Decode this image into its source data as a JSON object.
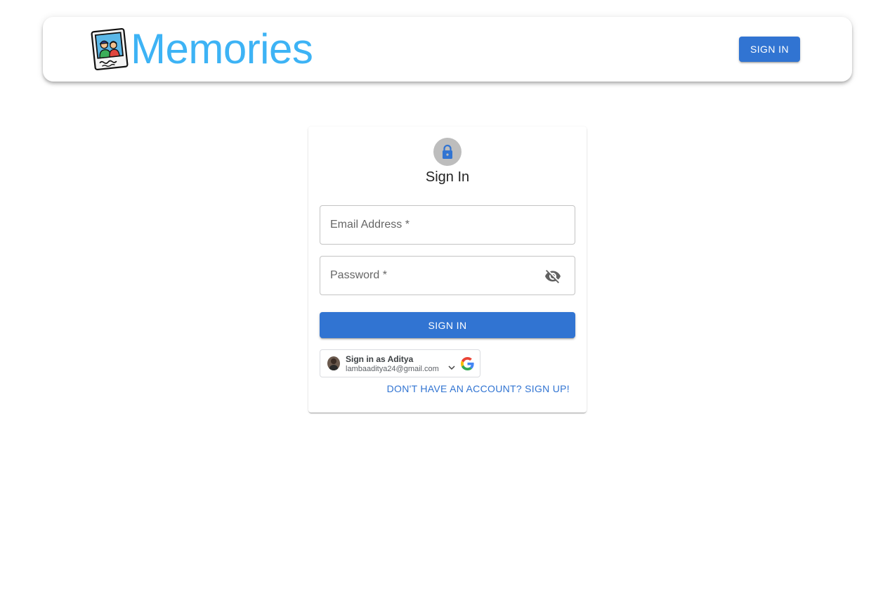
{
  "header": {
    "brand_title": "Memories",
    "signin_label": "SIGN IN",
    "logo_icon": "photo-memories-icon"
  },
  "colors": {
    "brand": "#3db3f5",
    "primary": "#3174d2",
    "lock_avatar_bg": "#bdbdbd"
  },
  "auth": {
    "title": "Sign In",
    "lock_icon": "lock-icon",
    "email": {
      "placeholder": "Email Address *",
      "value": ""
    },
    "password": {
      "placeholder": "Password *",
      "value": "",
      "toggle_icon": "visibility-off-icon"
    },
    "submit_label": "SIGN IN",
    "google": {
      "name_line": "Sign in as Aditya",
      "email": "lambaaditya24@gmail.com",
      "chevron_icon": "chevron-down-icon",
      "logo_icon": "google-g-icon"
    },
    "switch_label": "DON'T HAVE AN ACCOUNT? SIGN UP!"
  }
}
